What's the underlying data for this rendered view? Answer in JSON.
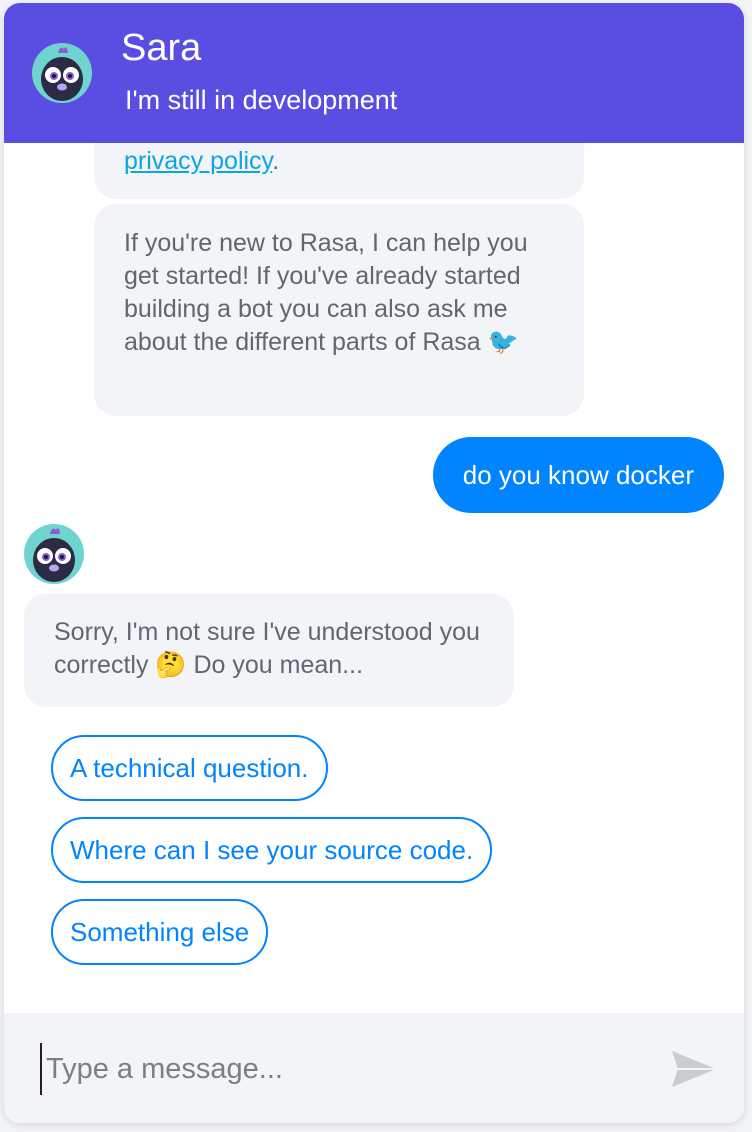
{
  "header": {
    "title": "Sara",
    "subtitle": "I'm still in development",
    "color": "#5a4de2"
  },
  "messages": {
    "bot_partial": {
      "link_text": "privacy policy",
      "trailing": "."
    },
    "bot_intro": "If you're new to Rasa, I can help you get started! If you've already started building a bot you can also ask me about the different parts of Rasa 🐦",
    "user_message": "do you know docker",
    "bot_fallback": "Sorry, I'm not sure I've understood you correctly 🤔 Do you mean..."
  },
  "quick_replies": [
    "A technical question.",
    "Where can I see your source code.",
    "Something else"
  ],
  "composer": {
    "placeholder": "Type a message..."
  },
  "colors": {
    "user_bubble": "#0084ff",
    "bot_bubble": "#f2f4f7",
    "link": "#0aa6e4"
  }
}
